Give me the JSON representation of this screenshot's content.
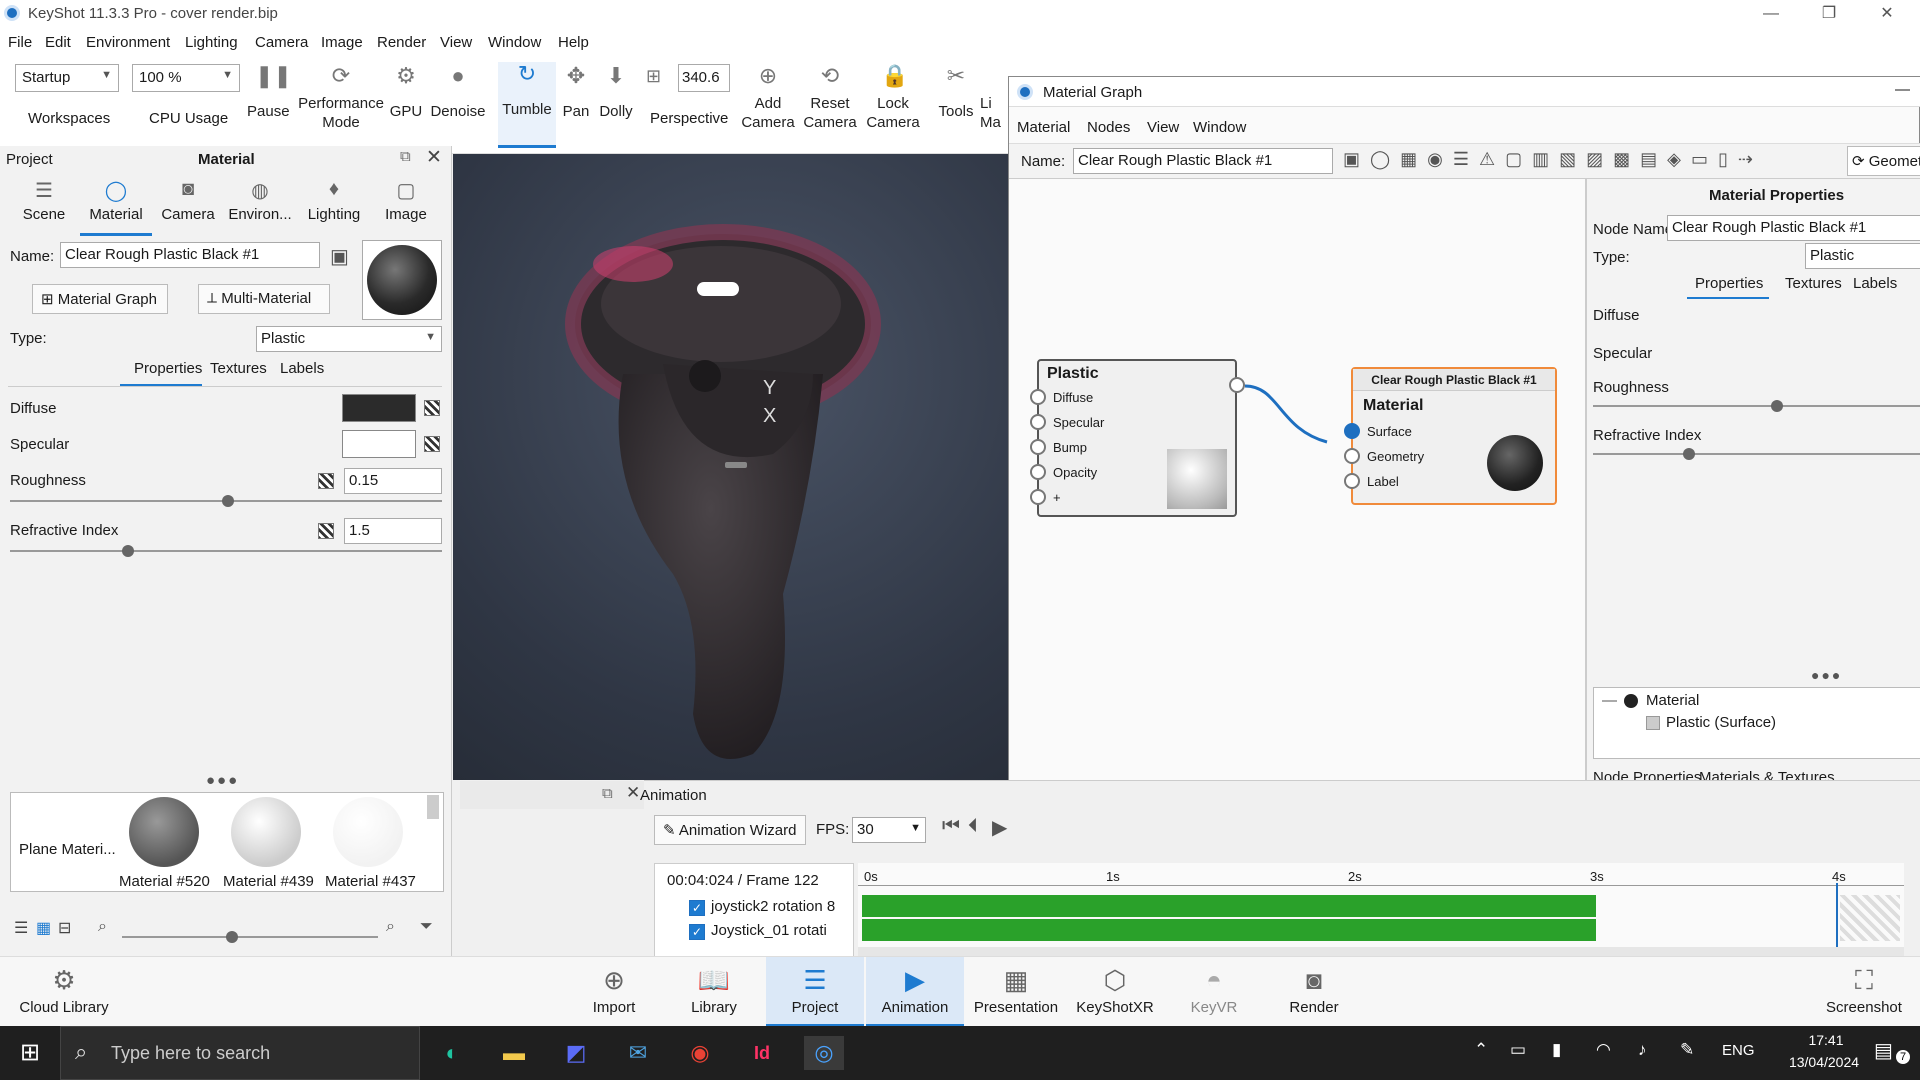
{
  "app": {
    "title": "KeyShot 11.3.3 Pro - cover render.bip"
  },
  "menu": [
    "File",
    "Edit",
    "Environment",
    "Lighting",
    "Camera",
    "Image",
    "Render",
    "View",
    "Window",
    "Help"
  ],
  "ribbon": {
    "workspace_value": "Startup",
    "workspaces_label": "Workspaces",
    "cpu_value": "100 %",
    "cpu_label": "CPU Usage",
    "pause": "Pause",
    "performance1": "Performance",
    "performance2": "Mode",
    "gpu": "GPU",
    "denoise": "Denoise",
    "tumble": "Tumble",
    "pan": "Pan",
    "dolly": "Dolly",
    "fov_value": "340.6",
    "perspective": "Perspective",
    "add1": "Add",
    "add2": "Camera",
    "reset1": "Reset",
    "reset2": "Camera",
    "lock1": "Lock",
    "lock2": "Camera",
    "tools": "Tools",
    "cut1": "Li",
    "cut2": "Ma"
  },
  "left": {
    "project": "Project",
    "material": "Material",
    "tabs": [
      "Scene",
      "Material",
      "Camera",
      "Environ...",
      "Lighting",
      "Image"
    ],
    "name_label": "Name:",
    "name_value": "Clear Rough Plastic Black #1",
    "material_graph_btn": "Material Graph",
    "multi_material_btn": "Multi-Material",
    "type_label": "Type:",
    "type_value": "Plastic",
    "subtabs": [
      "Properties",
      "Textures",
      "Labels"
    ],
    "diffuse": "Diffuse",
    "specular": "Specular",
    "roughness": "Roughness",
    "roughness_value": "0.15",
    "refractive": "Refractive Index",
    "refractive_value": "1.5",
    "library": [
      "Plane Materi...",
      "Material #520",
      "Material #439",
      "Material #437"
    ]
  },
  "graph": {
    "title": "Material Graph",
    "menu": [
      "Material",
      "Nodes",
      "View",
      "Window"
    ],
    "name_label": "Name:",
    "name_value": "Clear Rough Plastic Black #1",
    "geom_cut": "Geomet",
    "plastic_node": {
      "title": "Plastic",
      "ports": [
        "Diffuse",
        "Specular",
        "Bump",
        "Opacity",
        "+"
      ]
    },
    "material_node": {
      "header": "Clear Rough Plastic Black #1",
      "title": "Material",
      "ports": [
        "Surface",
        "Geometry",
        "Label"
      ]
    },
    "props": {
      "title": "Material Properties",
      "node_name_label": "Node Name:",
      "node_name_value": "Clear Rough Plastic Black #1",
      "type_label": "Type:",
      "type_value": "Plastic",
      "subtabs": [
        "Properties",
        "Textures",
        "Labels"
      ],
      "diffuse": "Diffuse",
      "specular": "Specular",
      "roughness": "Roughness",
      "refractive": "Refractive Index",
      "tree_root": "Material",
      "tree_child": "Plastic (Surface)",
      "bottom_tabs": [
        "Node Properties",
        "Materials & Textures"
      ]
    }
  },
  "animation": {
    "title": "Animation",
    "wizard": "Animation Wizard",
    "fps_label": "FPS:",
    "fps_value": "30",
    "time": "00:04:024 / Frame 122",
    "tracks": [
      "joystick2 rotation 8",
      "Joystick_01 rotati"
    ],
    "ticks": [
      "0s",
      "1s",
      "2s",
      "3s",
      "4s"
    ]
  },
  "bottom": {
    "cloud": "Cloud Library",
    "items": [
      "Import",
      "Library",
      "Project",
      "Animation",
      "Presentation",
      "KeyShotXR",
      "KeyVR",
      "Render"
    ],
    "screenshot": "Screenshot"
  },
  "taskbar": {
    "search": "Type here to search",
    "lang": "ENG",
    "time": "17:41",
    "date": "13/04/2024",
    "notif": "7"
  }
}
